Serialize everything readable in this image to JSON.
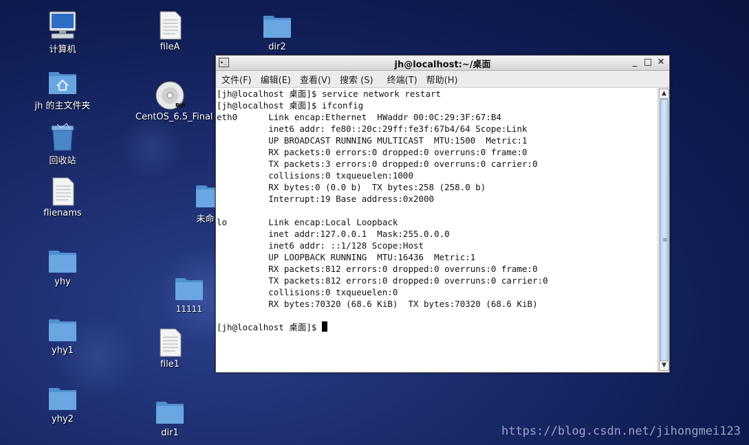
{
  "desktop": {
    "icons": [
      {
        "label": "计算机",
        "icon": "computer-icon"
      },
      {
        "label": "fileA",
        "icon": "document-icon"
      },
      {
        "label": "dir2",
        "icon": "folder-icon"
      },
      {
        "label": "jh 的主文件夹",
        "icon": "home-folder-icon"
      },
      {
        "label": "CentOS_6.5_Final",
        "icon": "dvd-icon",
        "badge": "DVD"
      },
      {
        "label": "回收站",
        "icon": "trash-icon"
      },
      {
        "label": "flienams",
        "icon": "document-icon"
      },
      {
        "label": "未命名",
        "icon": "folder-icon"
      },
      {
        "label": "yhy",
        "icon": "folder-icon"
      },
      {
        "label": "11111",
        "icon": "folder-icon"
      },
      {
        "label": "yhy1",
        "icon": "folder-icon"
      },
      {
        "label": "file1",
        "icon": "document-icon"
      },
      {
        "label": "yhy2",
        "icon": "folder-icon"
      },
      {
        "label": "dir1",
        "icon": "folder-icon"
      }
    ]
  },
  "window": {
    "title": "jh@localhost:~/桌面",
    "icon_text": "▸_",
    "controls": {
      "minimize": "_",
      "maximize": "□",
      "close": "✕"
    },
    "menu": [
      "文件(F)",
      "编辑(E)",
      "查看(V)",
      "搜索 (S)",
      "终端(T)",
      "帮助(H)"
    ]
  },
  "terminal": {
    "output": "[jh@localhost 桌面]$ service network restart\n[jh@localhost 桌面]$ ifconfig\neth0      Link encap:Ethernet  HWaddr 00:0C:29:3F:67:B4\n          inet6 addr: fe80::20c:29ff:fe3f:67b4/64 Scope:Link\n          UP BROADCAST RUNNING MULTICAST  MTU:1500  Metric:1\n          RX packets:0 errors:0 dropped:0 overruns:0 frame:0\n          TX packets:3 errors:0 dropped:0 overruns:0 carrier:0\n          collisions:0 txqueuelen:1000\n          RX bytes:0 (0.0 b)  TX bytes:258 (258.0 b)\n          Interrupt:19 Base address:0x2000\n\nlo        Link encap:Local Loopback\n          inet addr:127.0.0.1  Mask:255.0.0.0\n          inet6 addr: ::1/128 Scope:Host\n          UP LOOPBACK RUNNING  MTU:16436  Metric:1\n          RX packets:812 errors:0 dropped:0 overruns:0 frame:0\n          TX packets:812 errors:0 dropped:0 overruns:0 carrier:0\n          collisions:0 txqueuelen:0\n          RX bytes:70320 (68.6 KiB)  TX bytes:70320 (68.6 KiB)\n\n",
    "prompt": "[jh@localhost 桌面]$ "
  },
  "scrollbar": {
    "up": "▲",
    "down": "▼",
    "grip": "≡"
  },
  "watermark": "https://blog.csdn.net/jihongmei123",
  "colors": {
    "desktop_bg": "#1a2a6a",
    "folder": "#5b9bd8",
    "terminal_bg": "#ffffff"
  }
}
